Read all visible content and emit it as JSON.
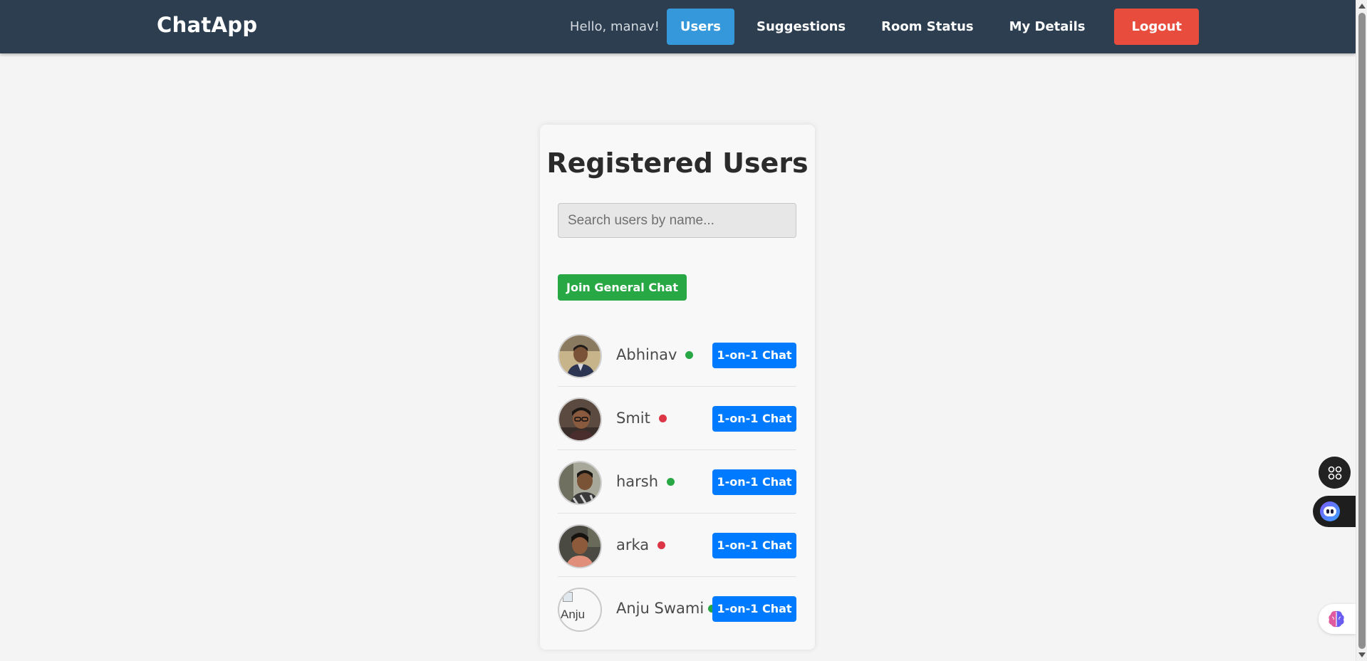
{
  "navbar": {
    "brand": "ChatApp",
    "greeting": "Hello, manav!",
    "links": [
      {
        "label": "Users",
        "active": true
      },
      {
        "label": "Suggestions",
        "active": false
      },
      {
        "label": "Room Status",
        "active": false
      },
      {
        "label": "My Details",
        "active": false
      }
    ],
    "logout_label": "Logout",
    "colors": {
      "bg": "#2c3e50",
      "active": "#3498db",
      "logout": "#e74c3c"
    }
  },
  "main": {
    "title": "Registered Users",
    "search_placeholder": "Search users by name...",
    "join_general_label": "Join General Chat",
    "chat_button_label": "1-on-1 Chat",
    "users": [
      {
        "name": "Abhinav",
        "status": "online",
        "avatar": "photo"
      },
      {
        "name": "Smit",
        "status": "offline",
        "avatar": "photo"
      },
      {
        "name": "harsh",
        "status": "online",
        "avatar": "photo"
      },
      {
        "name": "arka",
        "status": "offline",
        "avatar": "photo"
      },
      {
        "name": "Anju Swami",
        "status": "online",
        "avatar": "broken-image",
        "avatar_alt": "Anju"
      }
    ],
    "status_colors": {
      "online": "#28a745",
      "offline": "#dc3545"
    }
  },
  "floating": {
    "grid_icon": "command-grid-icon",
    "bot_icon": "assistant-bot-icon",
    "brain_icon": "brain-icon"
  }
}
